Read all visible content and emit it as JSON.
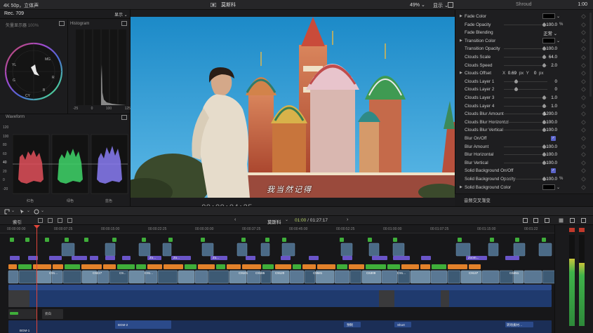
{
  "topbar": {
    "format": "4K 50p，立体声",
    "project_title": "莫斯科",
    "zoom": "49%",
    "display": "显示",
    "library": "Shroud",
    "time": "1:00"
  },
  "scopes": {
    "recording": "Rec. 709",
    "display": "显示",
    "vectorscope_label": "矢量显示器",
    "vectorscope_pct": "100%",
    "vector_marks": [
      "R",
      "MG",
      "B",
      "CY",
      "G",
      "YL"
    ],
    "histogram_label": "Histogram",
    "histogram_ticks": [
      "-25",
      "0",
      "100",
      "125"
    ],
    "waveform_label": "Waveform",
    "waveform_scale": [
      "120",
      "100",
      "80",
      "60",
      "40",
      "20",
      "0",
      "-20"
    ],
    "waveform_channels": [
      "红色",
      "绿色",
      "蓝色"
    ],
    "waveform_colors": [
      "#e0505a",
      "#3fd66a",
      "#8a7cf5"
    ]
  },
  "viewer": {
    "timecode": "00:00:04:25",
    "subtitle": "我当然记得"
  },
  "inspector": {
    "rows": [
      {
        "label": "Fade Color",
        "type": "color",
        "tri": true
      },
      {
        "label": "Fade Opacity",
        "type": "slider",
        "value": "100.0",
        "unit": "%",
        "knob": 0.95
      },
      {
        "label": "Fade Blending",
        "type": "select",
        "value": "正常"
      },
      {
        "label": "Transition Color",
        "type": "color",
        "tri": true
      },
      {
        "label": "Transition Opacity",
        "type": "slider",
        "value": "100.0",
        "knob": 0.95
      },
      {
        "label": "Clouds Scale",
        "type": "slider",
        "value": "64.0",
        "knob": 0.95
      },
      {
        "label": "Clouds Speed",
        "type": "slider",
        "value": "2.0",
        "knob": 0.95
      },
      {
        "label": "Clouds Offset",
        "type": "xy",
        "x": "0.69",
        "y": "0",
        "unit": "px",
        "tri": true
      },
      {
        "label": "Clouds Layer 1",
        "type": "slider",
        "value": "0",
        "knob": 0.25
      },
      {
        "label": "Clouds Layer 2",
        "type": "slider",
        "value": "0",
        "knob": 0.25
      },
      {
        "label": "Clouds Layer 3",
        "type": "slider",
        "value": "1.0",
        "knob": 0.95
      },
      {
        "label": "Clouds Layer 4",
        "type": "slider",
        "value": "1.0",
        "knob": 0.95
      },
      {
        "label": "Clouds Blur Amount",
        "type": "slider",
        "value": "1200.0",
        "knob": 0.95
      },
      {
        "label": "Clouds Blur Horizontal",
        "type": "slider",
        "value": "100.0",
        "knob": 0.95
      },
      {
        "label": "Clouds Blur Vertical",
        "type": "slider",
        "value": "100.0",
        "knob": 0.95
      },
      {
        "label": "Blur On/Off",
        "type": "check"
      },
      {
        "label": "Blur Amount",
        "type": "slider",
        "value": "100.0",
        "knob": 0.95
      },
      {
        "label": "Blur Horizontal",
        "type": "slider",
        "value": "100.0",
        "knob": 0.95
      },
      {
        "label": "Blur Vertical",
        "type": "slider",
        "value": "100.0",
        "knob": 0.95
      },
      {
        "label": "Solid Background On/Off",
        "type": "check"
      },
      {
        "label": "Solid Background Opacity",
        "type": "slider",
        "value": "100.0",
        "unit": "%",
        "knob": 0.95
      },
      {
        "label": "Solid Background Color",
        "type": "color",
        "tri": true
      }
    ],
    "audio_section": "音频交叉渐变"
  },
  "timeline": {
    "index_tab": "索引",
    "project": "莫斯科",
    "timecode_current": "01:00",
    "timecode_total": "01:27:17",
    "ruler": [
      "00:00:00:00",
      "00:00:07:25",
      "00:00:15:00",
      "00:00:22:25",
      "00:00:30:00",
      "00:00:37:25",
      "00:00:45:00",
      "00:00:52:25",
      "00:01:00:00",
      "00:01:07:25",
      "00:01:15:00",
      "00:01:22"
    ],
    "audio_labels": [
      "BGM-1",
      "BGM-2",
      "旁白"
    ],
    "title_clips": [
      "Zo...",
      "Zo...",
      "Zo...",
      "Zoom...",
      "Z...",
      "Zo...",
      "Zo...",
      "Z..."
    ],
    "clip_labels": [
      "C91...",
      "C9227",
      "C9...",
      "C91...",
      "C9101",
      "C9165",
      "C9120",
      "C9581",
      "C6309",
      "C91...",
      "C9137",
      "C6451"
    ],
    "bottom_labels": [
      "BGM-1",
      "BGM-2",
      "旁白",
      "预制",
      "Short",
      "转场素材…"
    ]
  }
}
